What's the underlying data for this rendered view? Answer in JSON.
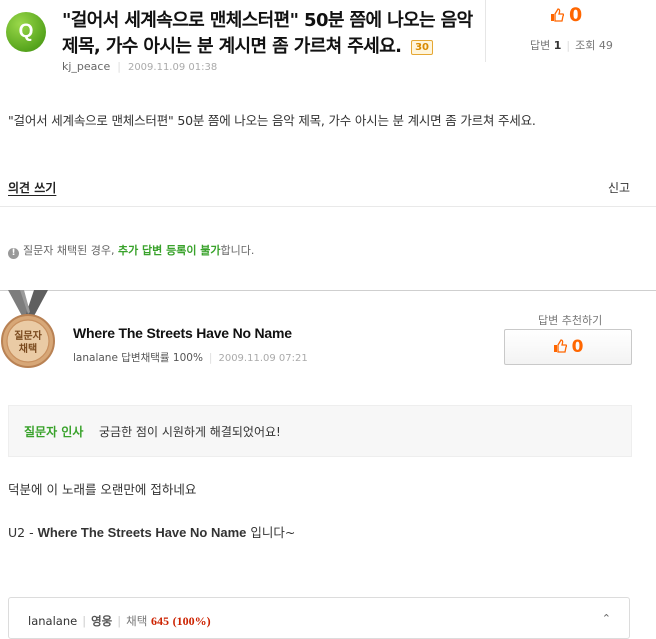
{
  "question": {
    "badge": "Q",
    "title": "\"걸어서 세계속으로 맨체스터편\" 50분 쯤에 나오는 음악 제목, 가수 아시는 분 계시면 좀 가르쳐 주세요.",
    "points": "30",
    "author": "kj_peace",
    "date": "2009.11.09 01:38",
    "body": "\"걸어서 세계속으로 맨체스터편\" 50분 쯤에 나오는 음악 제목, 가수 아시는 분 계시면 좀 가르쳐 주세요."
  },
  "stats": {
    "likes": "0",
    "answers_label": "답변",
    "answers_count": "1",
    "views_label": "조회",
    "views_count": "49"
  },
  "actions": {
    "opinion": "의견 쓰기",
    "report": "신고"
  },
  "notice": {
    "prefix": "질문자 채택된 경우, ",
    "highlight": "추가 답변 등록이 불가",
    "suffix": "합니다."
  },
  "answer": {
    "medal_line1": "질문자",
    "medal_line2": "채택",
    "title": "Where The Streets Have No Name",
    "author": "lanalane",
    "adoption_rate": "답변채택률 100%",
    "date": "2009.11.09 07:21",
    "recommend_label": "답변 추천하기",
    "recommend_count": "0",
    "thanks_label": "질문자 인사",
    "thanks_message": "궁금한 점이 시원하게 해결되었어요!",
    "body_line1": "덕분에 이 노래를 오랜만에 접하네요",
    "body_line2_prefix": "U2 - ",
    "body_line2_song": "Where The Streets Have No Name",
    "body_line2_suffix": " 입니다~"
  },
  "profile": {
    "name": "lanalane",
    "grade": "영웅",
    "adoption_label": "채택",
    "adoption_count": "645",
    "adoption_pct": "(100%)",
    "toggle_icon": "caret-up-icon"
  },
  "colors": {
    "green": "#39a22b",
    "orange": "#ff6600",
    "red": "#cc2200"
  }
}
